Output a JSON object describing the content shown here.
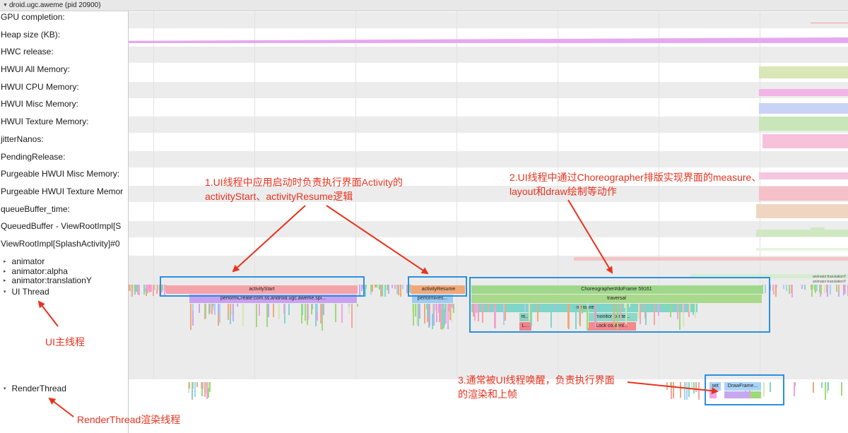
{
  "header": {
    "process_title": "droid.ugc.aweme (pid 20900)"
  },
  "counter_tracks": [
    {
      "label": "GPU completion:"
    },
    {
      "label": "Heap size (KB):"
    },
    {
      "label": "HWC release:"
    },
    {
      "label": "HWUI All Memory:"
    },
    {
      "label": "HWUI CPU Memory:"
    },
    {
      "label": "HWUI Misc Memory:"
    },
    {
      "label": "HWUI Texture Memory:"
    },
    {
      "label": "jitterNanos:"
    },
    {
      "label": "PendingRelease:"
    },
    {
      "label": "Purgeable HWUI Misc Memory:"
    },
    {
      "label": "Purgeable HWUI Texture Memor"
    },
    {
      "label": "queueBuffer_time:"
    },
    {
      "label": "QueuedBuffer - ViewRootImpl[S"
    },
    {
      "label": "ViewRootImpl[SplashActivity]#0"
    }
  ],
  "thread_groups": [
    {
      "label": "animator"
    },
    {
      "label": "animator:alpha"
    },
    {
      "label": "animator:translationY"
    },
    {
      "label": "UI Thread"
    },
    {
      "label": "RenderThread"
    }
  ],
  "slices": {
    "activity_start": "activityStart",
    "perform_create": "performCreate:com.ss.android.ugc.aweme.spl...",
    "activity_resume": "activityResume",
    "perform_resume": "performRes...",
    "choreographer": "Choreographer#doFrame 59161",
    "traversal": "traversal",
    "measure": "measure",
    "m_short": "m...",
    "monitor": "monitor conte...",
    "l_short": "L...",
    "lock": "Lock content...",
    "set": "set",
    "draw_frame": "DrawFrame...",
    "anim_label_1": "animator:translationY",
    "anim_label_2": "animator:translationY"
  },
  "annotations": {
    "a1_line1": "1.UI线程中应用启动时负责执行界面Activity的",
    "a1_line2": "activityStart、activityResume逻辑",
    "a2_line1": "2.UI线程中通过Choreographer排版实现界面的measure、",
    "a2_line2": "layout和draw绘制等动作",
    "a3_line1": "3.通常被UI线程唤醒，负责执行界面",
    "a3_line2": "的渲染和上帧",
    "ui_main": "UI主线程",
    "render_thread": "RenderThread渲染线程"
  },
  "colors": {
    "annotation_red": "#e8321e",
    "highlight_blue": "#2b90e0",
    "heap": "#e6a8f0",
    "hwui_all": "#d9e6b5",
    "hwui_cpu": "#f2b4e6",
    "hwui_misc": "#c9d2f7",
    "hwui_texture": "#c8e6b8",
    "jitter": "#f7c1db",
    "queue_time": "#f0d6c0",
    "queued_buffer": "#cfe8c2"
  }
}
